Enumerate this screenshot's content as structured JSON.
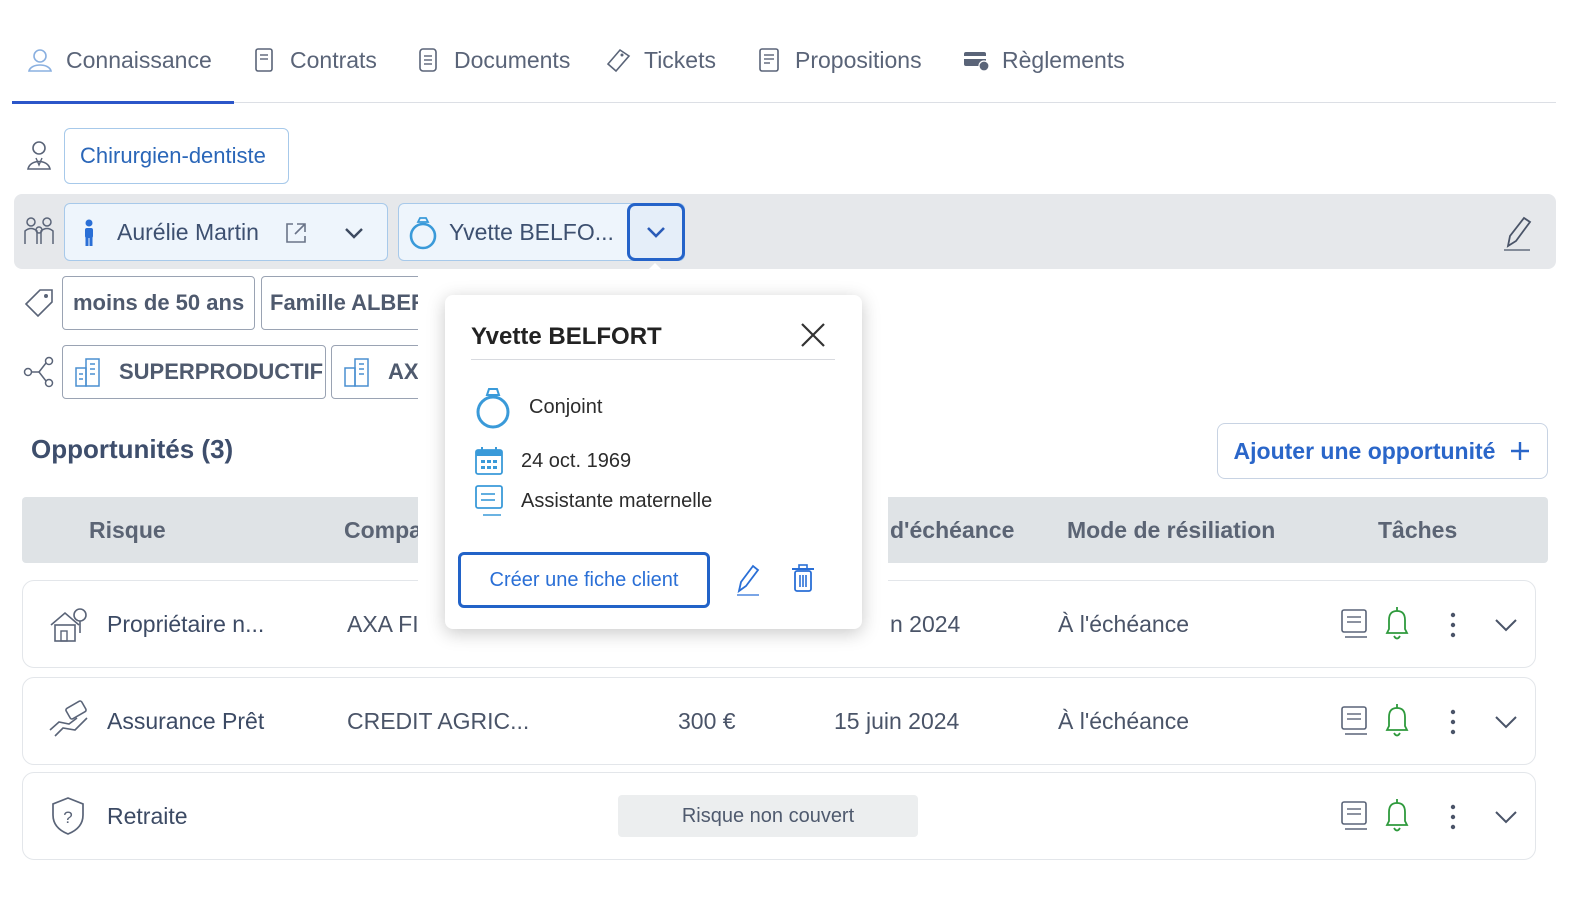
{
  "tabs": [
    {
      "label": "Connaissance",
      "icon": "user-knowledge-icon",
      "active": true
    },
    {
      "label": "Contrats",
      "icon": "contract-icon"
    },
    {
      "label": "Documents",
      "icon": "document-icon"
    },
    {
      "label": "Tickets",
      "icon": "ticket-icon"
    },
    {
      "label": "Propositions",
      "icon": "proposal-icon"
    },
    {
      "label": "Règlements",
      "icon": "payment-icon"
    }
  ],
  "profession": "Chirurgien-dentiste",
  "family": {
    "person1": "Aurélie Martin",
    "person2": "Yvette BELFO..."
  },
  "tags": {
    "age": "moins de 50 ans",
    "family": "Famille ALBER"
  },
  "companies": {
    "c1": "SUPERPRODUCTIF",
    "c2": "AX"
  },
  "opportunities": {
    "title": "Opportunités (3)",
    "add_label": "Ajouter une opportunité",
    "headers": {
      "risk": "Risque",
      "company": "Compa",
      "due": "d'échéance",
      "termination": "Mode de résiliation",
      "tasks": "Tâches"
    },
    "rows": [
      {
        "risk": "Propriétaire n...",
        "company": "AXA FI",
        "amount": "",
        "due": "n 2024",
        "termination": "À l'échéance"
      },
      {
        "risk": "Assurance Prêt",
        "company": "CREDIT AGRIC...",
        "amount": "300 €",
        "due": "15 juin 2024",
        "termination": "À l'échéance"
      },
      {
        "risk": "Retraite",
        "badge": "Risque non couvert"
      }
    ]
  },
  "popup": {
    "name": "Yvette BELFORT",
    "relation": "Conjoint",
    "birthdate": "24 oct. 1969",
    "job": "Assistante maternelle",
    "create_label": "Créer une fiche client"
  },
  "colors": {
    "accent": "#2b56c9",
    "bell": "#2e9a3c",
    "ring": "#3a9ad9"
  }
}
